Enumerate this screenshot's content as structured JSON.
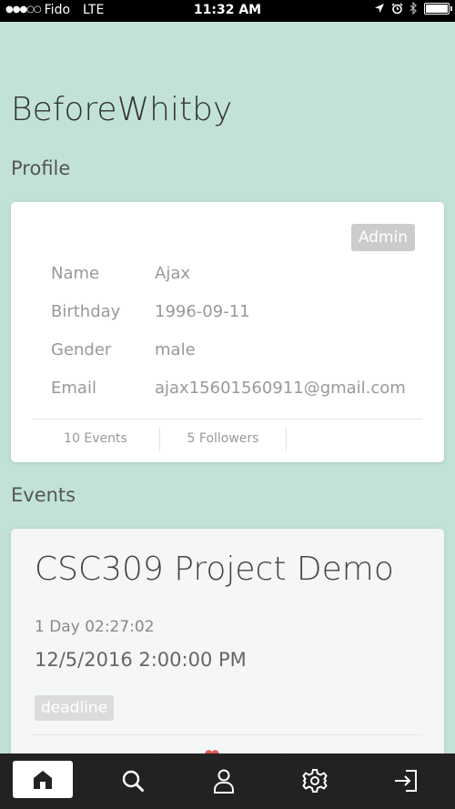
{
  "status_bar": {
    "signal": "●●●○○",
    "carrier": "Fido",
    "network": "LTE",
    "time": "11:32 AM"
  },
  "app": {
    "title": "BeforeWhitby"
  },
  "profile": {
    "section_title": "Profile",
    "badge": "Admin",
    "fields": [
      {
        "label": "Name",
        "value": "Ajax"
      },
      {
        "label": "Birthday",
        "value": "1996-09-11"
      },
      {
        "label": "Gender",
        "value": "male"
      },
      {
        "label": "Email",
        "value": "ajax15601560911@gmail.com"
      }
    ],
    "stats": {
      "events": "10 Events",
      "followers": "5 Followers"
    }
  },
  "events": {
    "section_title": "Events",
    "items": [
      {
        "title": "CSC309 Project Demo",
        "countdown": "1 Day 02:27:02",
        "datetime": "12/5/2016 2:00:00 PM",
        "tag": "deadline"
      }
    ]
  },
  "tabbar": {
    "items": [
      {
        "icon": "home-icon",
        "active": true
      },
      {
        "icon": "search-icon",
        "active": false
      },
      {
        "icon": "user-icon",
        "active": false
      },
      {
        "icon": "gear-icon",
        "active": false
      },
      {
        "icon": "logout-icon",
        "active": false
      }
    ]
  },
  "colors": {
    "background": "#c2e2d9",
    "tabbar": "#222222",
    "badge": "#cccccc",
    "heart": "#e05555"
  }
}
